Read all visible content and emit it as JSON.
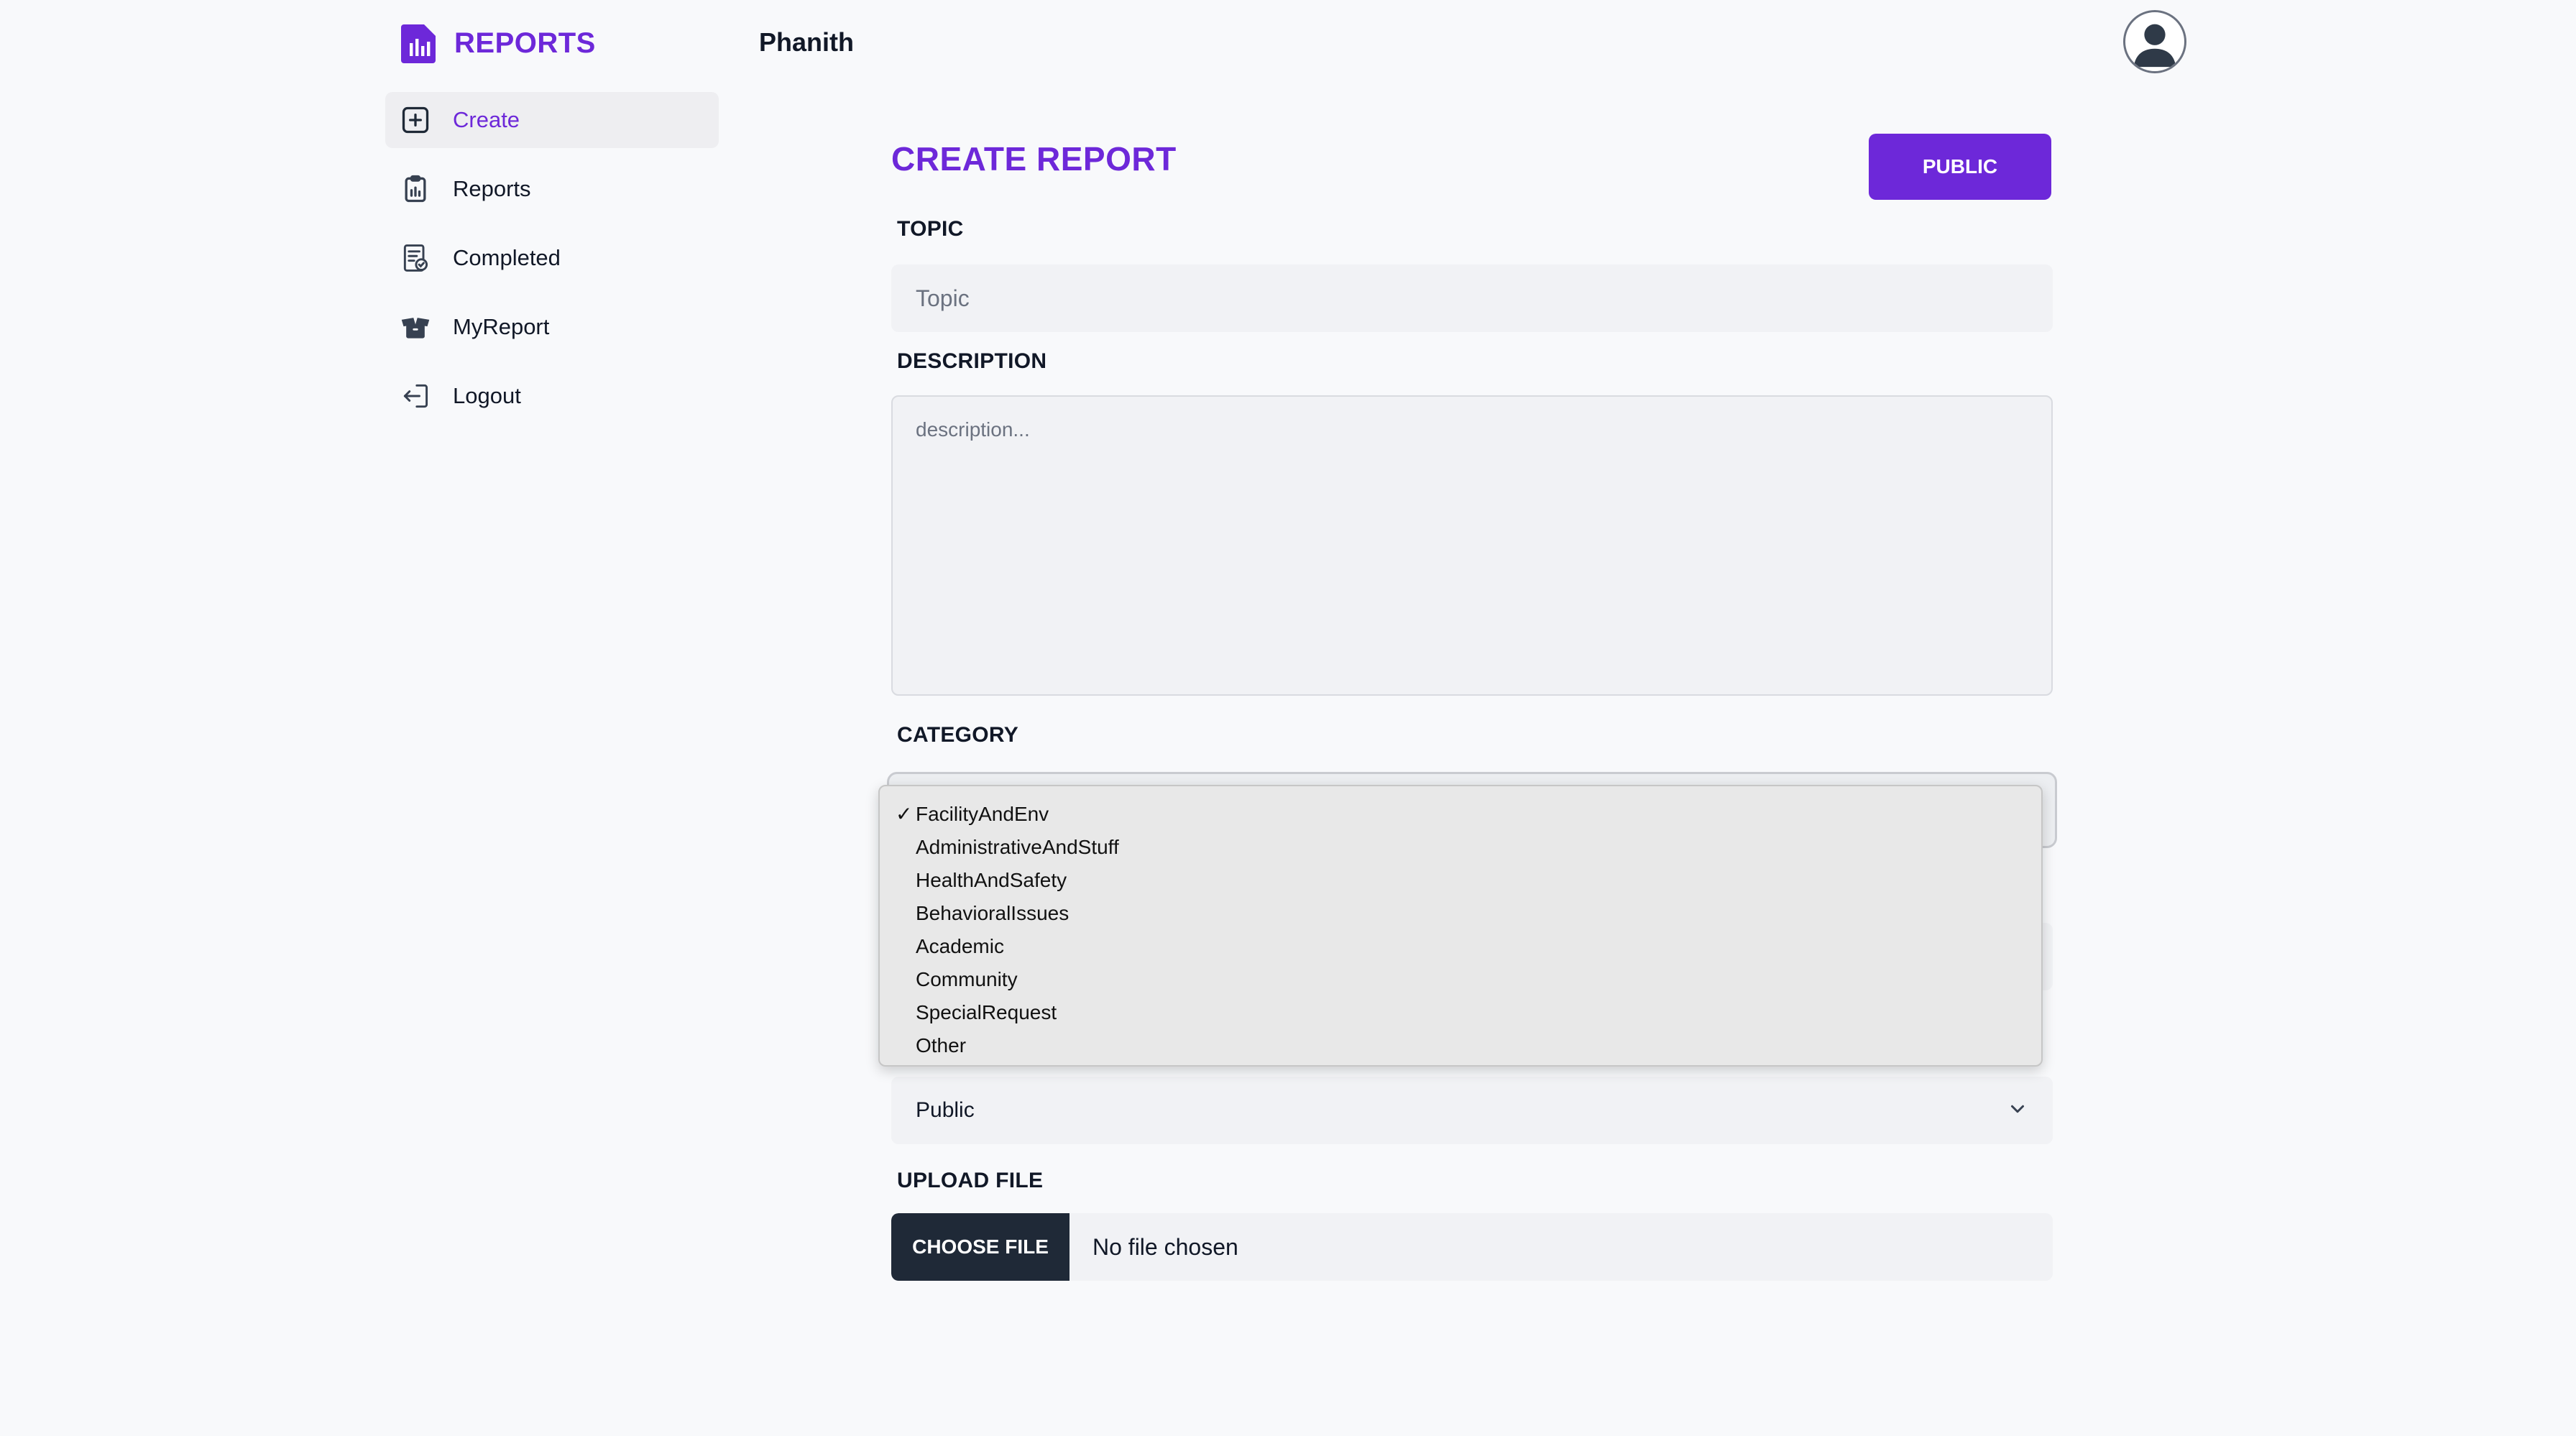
{
  "brand": {
    "title": "REPORTS"
  },
  "header": {
    "user_name": "Phanith"
  },
  "sidebar": {
    "items": [
      {
        "label": "Create",
        "icon": "plus-square-icon",
        "active": true
      },
      {
        "label": "Reports",
        "icon": "clipboard-chart-icon",
        "active": false
      },
      {
        "label": "Completed",
        "icon": "document-check-icon",
        "active": false
      },
      {
        "label": "MyReport",
        "icon": "open-box-icon",
        "active": false
      },
      {
        "label": "Logout",
        "icon": "logout-icon",
        "active": false
      }
    ]
  },
  "form": {
    "title": "CREATE REPORT",
    "visibility_button": "PUBLIC",
    "topic": {
      "label": "TOPIC",
      "placeholder": "Topic",
      "value": ""
    },
    "description": {
      "label": "DESCRIPTION",
      "placeholder": "description...",
      "value": ""
    },
    "category": {
      "label": "CATEGORY",
      "selected": "FacilityAndEnv",
      "options": [
        "FacilityAndEnv",
        "AdministrativeAndStuff",
        "HealthAndSafety",
        "BehavioralIssues",
        "Academic",
        "Community",
        "SpecialRequest",
        "Other"
      ]
    },
    "visibility": {
      "value": "Public"
    },
    "upload": {
      "label": "UPLOAD FILE",
      "button": "CHOOSE FILE",
      "status": "No file chosen"
    }
  },
  "colors": {
    "accent": "#6d28d9",
    "background": "#f8f9fb",
    "input_background": "#f1f2f5",
    "file_button": "#1f2937"
  }
}
